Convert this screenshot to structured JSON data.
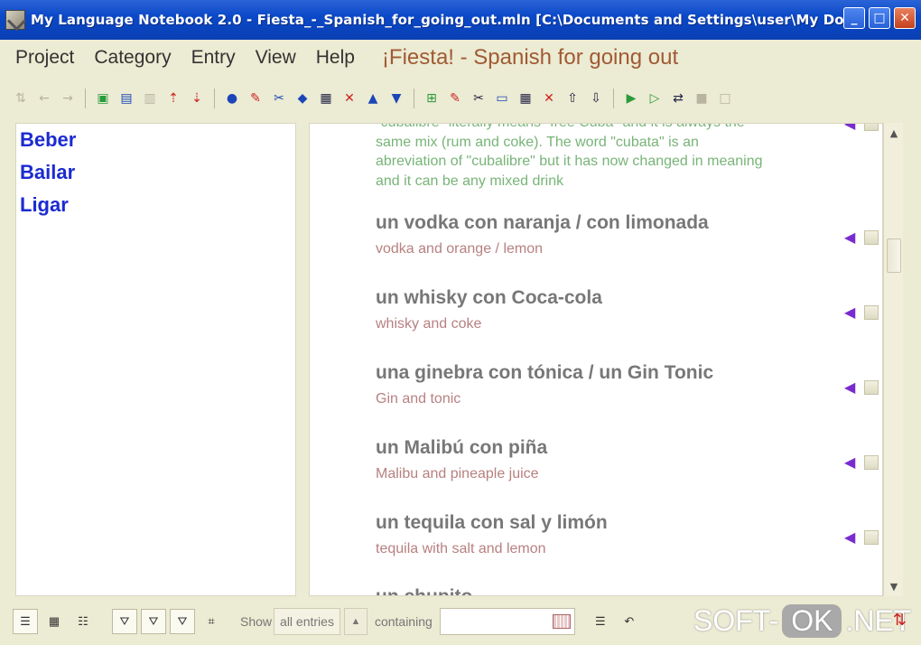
{
  "window": {
    "title": "My Language Notebook 2.0   -   Fiesta_-_Spanish_for_going_out.mln [C:\\Documents and Settings\\user\\My Do...",
    "minimize": "_",
    "maximize": "□",
    "close": "✕"
  },
  "menu": {
    "items": [
      "Project",
      "Category",
      "Entry",
      "View",
      "Help"
    ],
    "project_title": "¡Fiesta! - Spanish for going out"
  },
  "categories": [
    "Beber",
    "Bailar",
    "Ligar"
  ],
  "note": "\"cubalibre\" literally means \"free Cuba\" and it is always the same mix (rum and coke). The word \"cubata\" is an abreviation of \"cubalibre\" but it has now changed in meaning and it can be any mixed drink",
  "entries": [
    {
      "term": "un vodka con naranja / con limonada",
      "translation": "vodka and orange / lemon"
    },
    {
      "term": "un whisky con Coca-cola",
      "translation": "whisky and coke"
    },
    {
      "term": "una ginebra con tónica / un Gin Tonic",
      "translation": "Gin and tonic"
    },
    {
      "term": "un Malibú con piña",
      "translation": "Malibu and pineaple juice"
    },
    {
      "term": "un tequila con sal y limón",
      "translation": "tequila with salt and lemon"
    },
    {
      "term": "un chupito",
      "translation": ""
    }
  ],
  "statusbar": {
    "show_label": "Show",
    "show_value": "all entries",
    "containing_label": "containing",
    "search_value": ""
  },
  "watermark": {
    "left": "SOFT-",
    "ok": "OK",
    "right": ".NET"
  }
}
